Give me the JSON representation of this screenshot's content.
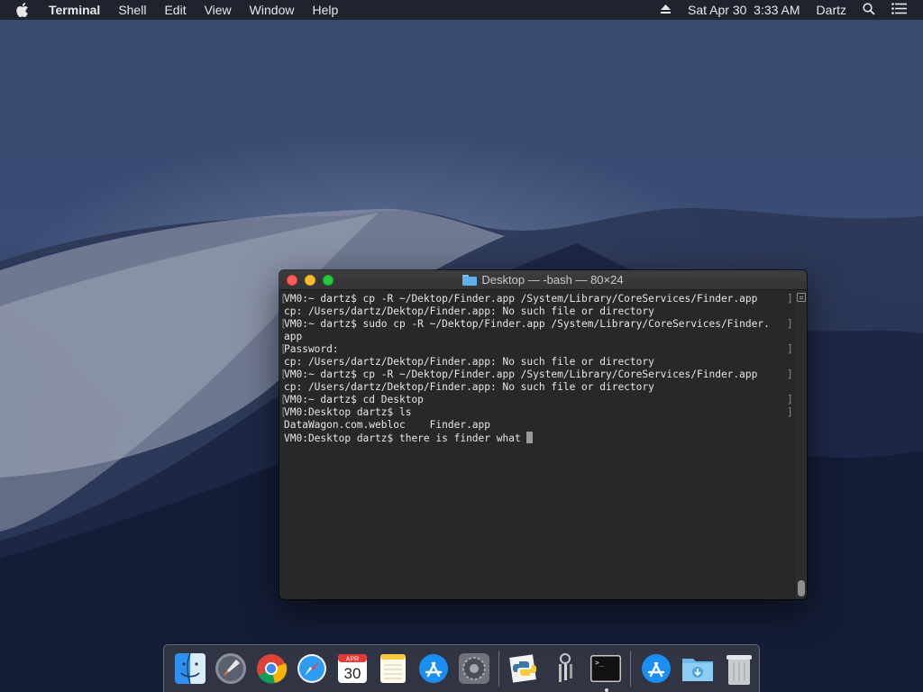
{
  "menubar": {
    "app_name": "Terminal",
    "menus": [
      "Shell",
      "Edit",
      "View",
      "Window",
      "Help"
    ],
    "clock": "Sat Apr 30  3:33 AM",
    "user": "Dartz"
  },
  "terminal": {
    "title": "Desktop — -bash — 80×24",
    "lines": [
      "VM0:~ dartz$ cp -R ~/Dektop/Finder.app /System/Library/CoreServices/Finder.app",
      "cp: /Users/dartz/Dektop/Finder.app: No such file or directory",
      "VM0:~ dartz$ sudo cp -R ~/Dektop/Finder.app /System/Library/CoreServices/Finder.",
      "app",
      "Password:",
      "cp: /Users/dartz/Dektop/Finder.app: No such file or directory",
      "VM0:~ dartz$ cp -R ~/Dektop/Finder.app /System/Library/CoreServices/Finder.app",
      "cp: /Users/dartz/Dektop/Finder.app: No such file or directory",
      "VM0:~ dartz$ cd Desktop",
      "VM0:Desktop dartz$ ls",
      "DataWagon.com.webloc    Finder.app",
      "VM0:Desktop dartz$ there is finder what "
    ]
  },
  "dock": {
    "calendar_month": "APR",
    "calendar_day": "30",
    "apps": [
      "finder-icon",
      "launchpad-icon",
      "chrome-icon",
      "safari-icon",
      "calendar-icon",
      "notes-icon",
      "app-store-icon",
      "system-preferences-icon",
      "python-launcher-icon",
      "keychain-icon",
      "terminal-icon",
      "app-store-downloads-icon",
      "downloads-folder-icon",
      "trash-icon"
    ]
  },
  "colors": {
    "close": "#fe5f57",
    "minimize": "#febc2e",
    "maximize": "#28c840",
    "terminal_bg": "#282828"
  }
}
